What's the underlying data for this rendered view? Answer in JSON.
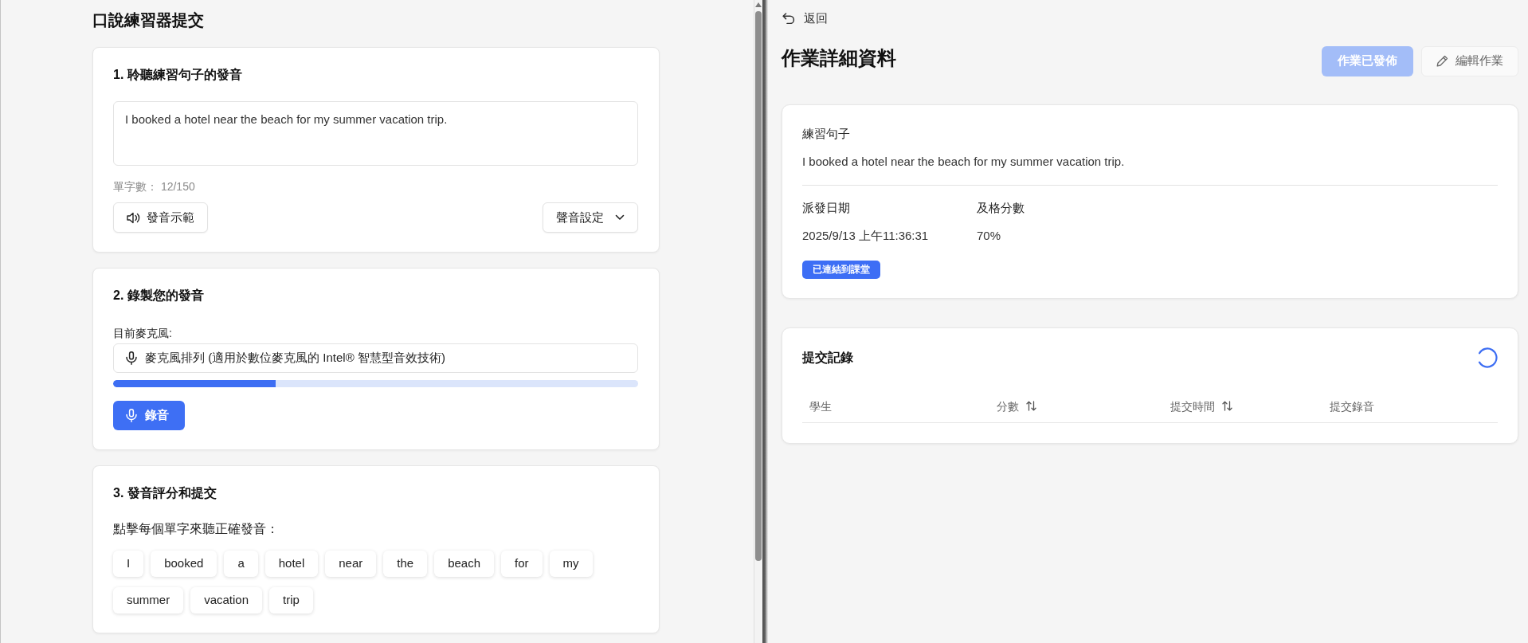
{
  "left_panel": {
    "title": "口說練習器提交",
    "sections": [
      {
        "kind": "listen",
        "heading": "1. 聆聽練習句子的發音",
        "sentence_field": {
          "value": "I booked a hotel near the beach for my summer vacation trip."
        },
        "word_count": "單字數： 12/150",
        "demo_button": "發音示範",
        "voice_settings_button": "聲音設定"
      },
      {
        "kind": "record",
        "heading": "2. 錄製您的發音",
        "mic_label": "目前麥克風:",
        "mic_device": "麥克風排列 (適用於數位麥克風的 Intel® 智慧型音效技術)",
        "input_meter": {
          "level": 0.31
        },
        "record_button": "錄音"
      },
      {
        "kind": "words",
        "heading": "3. 發音評分和提交",
        "instruction": "點擊每個單字來聽正確發音：",
        "words": [
          "I",
          "booked",
          "a",
          "hotel",
          "near",
          "the",
          "beach",
          "for",
          "my",
          "summer",
          "vacation",
          "trip"
        ]
      }
    ]
  },
  "right_panel": {
    "back_link": "返回",
    "title": "作業詳細資料",
    "publish_button": {
      "label": "作業已發佈",
      "disabled": true
    },
    "edit_button": "編輯作業",
    "details_card": {
      "sentence_label": "練習句子",
      "sentence": "I booked a hotel near the beach for my summer vacation trip.",
      "fields": [
        {
          "label": "派發日期",
          "value": "2025/9/13 上午11:36:31"
        },
        {
          "label": "及格分數",
          "value": "70%"
        }
      ],
      "badge": "已連結到課堂"
    },
    "submissions_card": {
      "title": "提交記錄",
      "loading": true,
      "columns": [
        {
          "label": "學生",
          "sortable": false
        },
        {
          "label": "分數",
          "sortable": true
        },
        {
          "label": "提交時間",
          "sortable": true
        },
        {
          "label": "提交錄音",
          "sortable": false
        }
      ]
    }
  }
}
